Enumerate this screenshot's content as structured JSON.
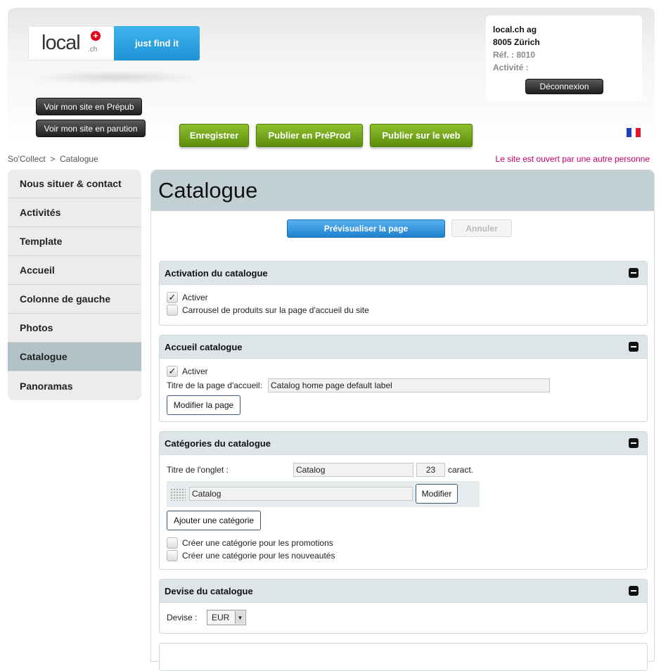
{
  "logo": {
    "word": "local",
    "suffix": ".ch",
    "tagline": "just find it"
  },
  "site_buttons": {
    "prepub": "Voir mon site en Prépub",
    "parution": "Voir mon site en parution"
  },
  "actions": {
    "save": "Enregistrer",
    "publish_preprod": "Publier en PréProd",
    "publish_web": "Publier sur le web"
  },
  "user": {
    "company": "local.ch ag",
    "city": "8005 Zürich",
    "ref": "Réf. : 8010",
    "activity": "Activité :",
    "logout": "Déconnexion"
  },
  "breadcrumb": {
    "root": "So'Collect",
    "separator": ">",
    "current": "Catalogue"
  },
  "warning": "Le site est ouvert par une autre personne",
  "sidebar": {
    "items": [
      {
        "label": "Nous situer & contact"
      },
      {
        "label": "Activités"
      },
      {
        "label": "Template"
      },
      {
        "label": "Accueil"
      },
      {
        "label": "Colonne de gauche"
      },
      {
        "label": "Photos"
      },
      {
        "label": "Catalogue"
      },
      {
        "label": "Panoramas"
      }
    ],
    "active": "Catalogue"
  },
  "main": {
    "title": "Catalogue",
    "preview": "Prévisualiser la page",
    "cancel": "Annuler"
  },
  "activation": {
    "title": "Activation du catalogue",
    "activate": "Activer",
    "activate_checked": true,
    "carousel": "Carrousel de produits sur la page d'accueil du site",
    "carousel_checked": false
  },
  "home": {
    "title": "Accueil catalogue",
    "activate": "Activer",
    "activate_checked": true,
    "page_title_label": "Titre de la page d'accueil:",
    "page_title_value": "Catalog home page default label",
    "modify": "Modifier la page"
  },
  "categories": {
    "title": "Catégories du catalogue",
    "tab_label": "Titre de l'onglet :",
    "tab_value": "Catalog",
    "char_count": "23",
    "char_unit": "caract.",
    "items": [
      {
        "name": "Catalog",
        "modify": "Modifier"
      }
    ],
    "add": "Ajouter une catégorie",
    "promo": "Créer une catégorie pour les promotions",
    "news": "Créer une catégorie pour les nouveautés"
  },
  "currency": {
    "title": "Devise du catalogue",
    "label": "Devise :",
    "value": "EUR"
  },
  "colors": {
    "accent_green": "#6c9e14",
    "accent_blue": "#2a8fd9",
    "warning": "#c3006b",
    "active_nav": "#b1c2c7"
  }
}
